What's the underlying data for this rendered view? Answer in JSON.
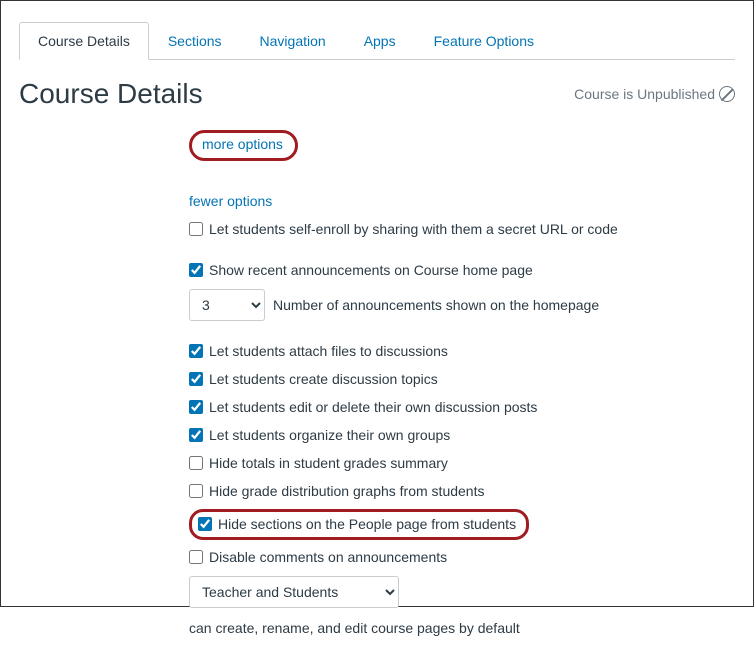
{
  "tabs": {
    "course_details": "Course Details",
    "sections": "Sections",
    "navigation": "Navigation",
    "apps": "Apps",
    "feature_options": "Feature Options"
  },
  "header": {
    "title": "Course Details",
    "unpublished": "Course is Unpublished"
  },
  "links": {
    "more_options": "more options",
    "fewer_options": "fewer options"
  },
  "checkboxes": {
    "self_enroll": "Let students self-enroll by sharing with them a secret URL or code",
    "announcements": "Show recent announcements on Course home page",
    "attach_files": "Let students attach files to discussions",
    "create_topics": "Let students create discussion topics",
    "edit_posts": "Let students edit or delete their own discussion posts",
    "organize_groups": "Let students organize their own groups",
    "hide_totals": "Hide totals in student grades summary",
    "hide_distribution": "Hide grade distribution graphs from students",
    "hide_sections": "Hide sections on the People page from students",
    "disable_comments": "Disable comments on announcements"
  },
  "selects": {
    "announcement_count": "3",
    "announcement_label": "Number of announcements shown on the homepage",
    "editor": "Teacher and Students"
  },
  "helper": {
    "pages_text": "can create, rename, and edit course pages by default"
  }
}
